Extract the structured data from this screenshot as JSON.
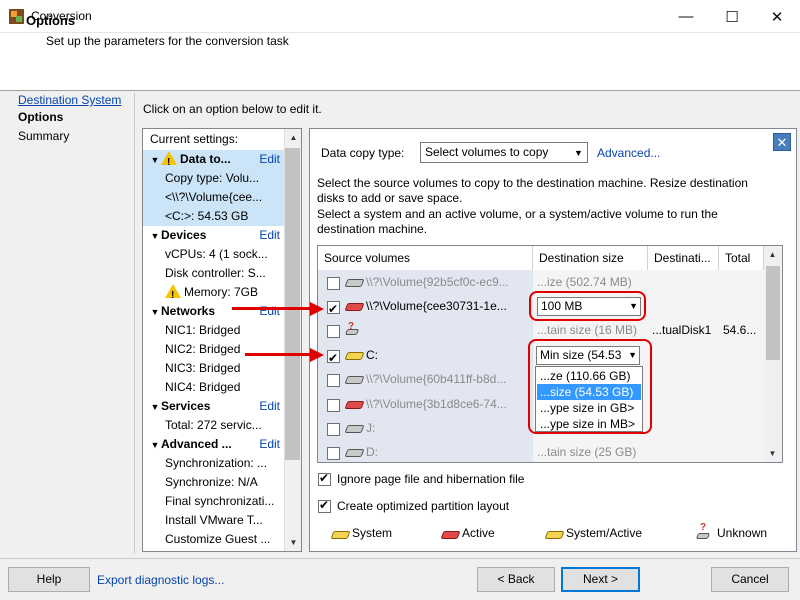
{
  "window": {
    "title": "Conversion",
    "minimize": "—",
    "maximize": "☐",
    "close": "✕"
  },
  "header": {
    "title": "Options",
    "subtitle": "Set up the parameters for the conversion task"
  },
  "nav": [
    "Destination System",
    "Options",
    "Summary"
  ],
  "instruction": "Click on an option below to edit it.",
  "current_settings": {
    "title": "Current settings:",
    "edit_label": "Edit",
    "data_to": {
      "label": "Data to...",
      "items": [
        "Copy type: Volu...",
        "<\\\\?\\Volume{cee...",
        "<C:>: 54.53 GB"
      ]
    },
    "devices": {
      "label": "Devices",
      "items": [
        "vCPUs: 4 (1 sock...",
        "Disk controller: S...",
        "Memory: 7GB"
      ]
    },
    "networks": {
      "label": "Networks",
      "items": [
        "NIC1: Bridged",
        "NIC2: Bridged",
        "NIC3: Bridged",
        "NIC4: Bridged"
      ]
    },
    "services": {
      "label": "Services",
      "items": [
        "Total: 272 servic..."
      ]
    },
    "advanced": {
      "label": "Advanced ...",
      "items": [
        "Synchronization: ...",
        "Synchronize: N/A",
        "Final synchronizati...",
        "Install VMware T...",
        "Customize Guest ..."
      ]
    }
  },
  "data_copy": {
    "label": "Data copy type:",
    "selected": "Select volumes to copy",
    "advanced_link": "Advanced...",
    "desc1": "Select the source volumes to copy to the destination machine. Resize destination disks to add or save space.",
    "desc2": "Select a system and an active volume, or a system/active volume to run the destination machine."
  },
  "table": {
    "headers": [
      "Source volumes",
      "Destination size",
      "Destinati...",
      "Total"
    ],
    "rows": [
      {
        "name": "\\\\?\\Volume{92b5cf0c-ec9...",
        "size": "...ize (502.74 MB)",
        "dest": "",
        "total": ""
      },
      {
        "name": "\\\\?\\Volume{cee30731-1e...",
        "size": "100 MB",
        "dest": "",
        "total": ""
      },
      {
        "name": "",
        "size": "...tain size (16 MB)",
        "dest": "...tualDisk1",
        "total": "54.6..."
      },
      {
        "name": "C:",
        "size": "Min size (54.53",
        "dest": "",
        "total": ""
      },
      {
        "name": "\\\\?\\Volume{60b411ff-b8d...",
        "size": "",
        "dest": "",
        "total": ""
      },
      {
        "name": "\\\\?\\Volume{3b1d8ce6-74...",
        "size": "",
        "dest": "",
        "total": ""
      },
      {
        "name": "J:",
        "size": "",
        "dest": "",
        "total": ""
      },
      {
        "name": "D:",
        "size": "...tain size (25 GB)",
        "dest": "",
        "total": ""
      }
    ],
    "size_options": [
      "...ze (110.66 GB)",
      "...size (54.53 GB)",
      "...ype size in GB>",
      "...ype size in MB>"
    ]
  },
  "options": {
    "ignore_page": "Ignore page file and hibernation file",
    "optimized": "Create optimized partition layout"
  },
  "legend": [
    "System",
    "Active",
    "System/Active",
    "Unknown"
  ],
  "buttons": {
    "help": "Help",
    "export": "Export diagnostic logs...",
    "back": "< Back",
    "next": "Next >",
    "cancel": "Cancel"
  },
  "colors": {
    "annotation": "#e00000",
    "selection": "#cce4f7",
    "link": "#0645ad"
  }
}
